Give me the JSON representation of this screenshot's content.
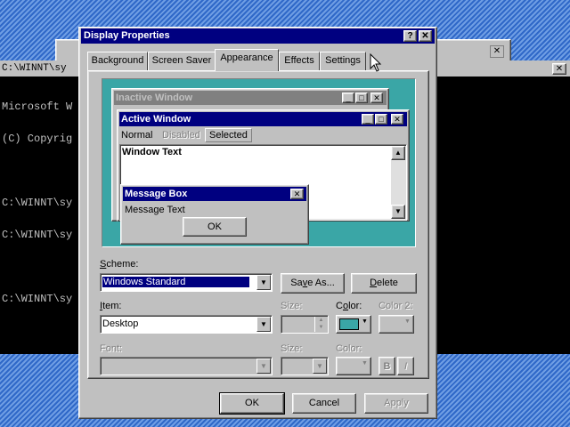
{
  "console": {
    "title": "C:\\WINNT\\sy",
    "lines": [
      "Microsoft W",
      "(C) Copyrig",
      "",
      "C:\\WINNT\\sy",
      "C:\\WINNT\\sy",
      "",
      "C:\\WINNT\\sy"
    ]
  },
  "dialog": {
    "title": "Display Properties",
    "help_btn": "?",
    "close_btn": "✕",
    "tabs": [
      "Background",
      "Screen Saver",
      "Appearance",
      "Effects",
      "Settings"
    ],
    "selected_tab": "Appearance"
  },
  "preview": {
    "inactive_title": "Inactive Window",
    "active_title": "Active Window",
    "menu_normal": "Normal",
    "menu_disabled": "Disabled",
    "menu_selected": "Selected",
    "window_text": "Window Text",
    "msgbox_title": "Message Box",
    "msgbox_text": "Message Text",
    "msgbox_ok": "OK"
  },
  "form": {
    "scheme_label": "Scheme:",
    "scheme_value": "Windows Standard",
    "save_as": "Save As...",
    "delete": "Delete",
    "item_label": "Item:",
    "item_value": "Desktop",
    "size_label": "Size:",
    "color_label": "Color:",
    "color2_label": "Color 2:",
    "color_value_hex": "#3aa6a6",
    "font_label": "Font:",
    "font_size_label": "Size:",
    "font_color_label": "Color:",
    "bold_btn": "B",
    "italic_btn": "I"
  },
  "buttons": {
    "ok": "OK",
    "cancel": "Cancel",
    "apply": "Apply"
  }
}
